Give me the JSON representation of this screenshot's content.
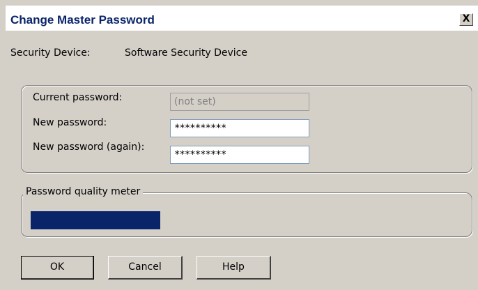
{
  "window": {
    "title": "Change Master Password",
    "close_label": "X"
  },
  "security_device": {
    "label": "Security Device:",
    "value": "Software Security Device"
  },
  "passwords": {
    "current_label": "Current password:",
    "current_value": "(not set)",
    "new_label": "New password:",
    "new_value": "**********",
    "again_label": "New password (again):",
    "again_value": "**********"
  },
  "quality_meter": {
    "label": "Password quality meter",
    "level_fraction": 0.3,
    "fill_color": "#0a246a"
  },
  "buttons": {
    "ok": "OK",
    "cancel": "Cancel",
    "help": "Help"
  }
}
